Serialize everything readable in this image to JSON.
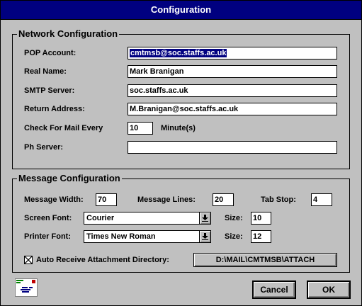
{
  "window": {
    "title": "Configuration"
  },
  "network": {
    "title": "Network Configuration",
    "pop_account_label": "POP Account:",
    "pop_account_value": "cmtmsb@soc.staffs.ac.uk",
    "real_name_label": "Real Name:",
    "real_name_value": "Mark Branigan",
    "smtp_server_label": "SMTP Server:",
    "smtp_server_value": "soc.staffs.ac.uk",
    "return_address_label": "Return Address:",
    "return_address_value": "M.Branigan@soc.staffs.ac.uk",
    "check_mail_label": "Check For Mail Every",
    "check_mail_value": "10",
    "check_mail_unit": "Minute(s)",
    "ph_server_label": "Ph Server:",
    "ph_server_value": ""
  },
  "message": {
    "title": "Message Configuration",
    "width_label": "Message Width:",
    "width_value": "70",
    "lines_label": "Message Lines:",
    "lines_value": "20",
    "tab_stop_label": "Tab Stop:",
    "tab_stop_value": "4",
    "screen_font_label": "Screen Font:",
    "screen_font_value": "Courier",
    "screen_size_label": "Size:",
    "screen_size_value": "10",
    "printer_font_label": "Printer Font:",
    "printer_font_value": "Times New Roman",
    "printer_size_label": "Size:",
    "printer_size_value": "12",
    "auto_receive_checked": true,
    "auto_receive_label": "Auto Receive Attachment Directory:",
    "attach_dir_button": "D:\\MAIL\\CMTMSB\\ATTACH"
  },
  "footer": {
    "icon": "app-icon",
    "cancel_label": "Cancel",
    "ok_label": "OK"
  },
  "colors": {
    "face": "#c0c0c0",
    "titlebar": "#000080",
    "selection": "#000080"
  }
}
